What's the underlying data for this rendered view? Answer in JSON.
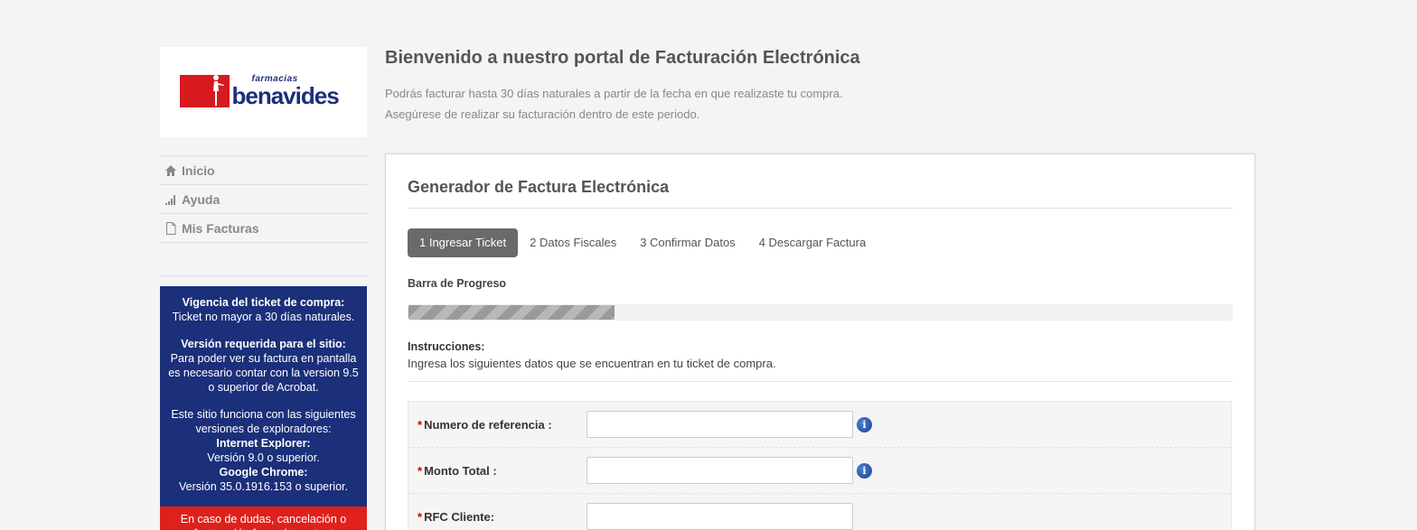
{
  "logo": {
    "small": "farmacias",
    "big": "benavides"
  },
  "nav": [
    {
      "label": "Inicio",
      "icon": "home-icon"
    },
    {
      "label": "Ayuda",
      "icon": "signal-bars-icon"
    },
    {
      "label": "Mis Facturas",
      "icon": "document-icon"
    }
  ],
  "info_box": {
    "vigencia_title": "Vigencia del ticket de compra:",
    "vigencia_text": "Ticket no mayor a 30 días naturales.",
    "version_title": "Versión requerida para el sitio:",
    "version_text": "Para poder ver su factura en pantalla es necesario contar con la version 9.5 o superior de Acrobat.",
    "browsers_text": "Este sitio funciona con las siguientes versiones de exploradores:",
    "ie_title": "Internet Explorer:",
    "ie_text": "Versión 9.0 o superior.",
    "chrome_title": "Google Chrome:",
    "chrome_text": "Versión 35.0.1916.153 o superior.",
    "red_text": "En caso de dudas, cancelación o refacturación favor de contactar"
  },
  "header": {
    "title": "Bienvenido a nuestro portal de Facturación Electrónica",
    "line1": "Podrás facturar hasta 30 días naturales a partir de la fecha en que realizaste tu compra.",
    "line2": "Asegúrese de realizar su facturación dentro de este periodo."
  },
  "panel": {
    "title": "Generador de Factura Electrónica",
    "tabs": [
      "1 Ingresar Ticket",
      "2 Datos Fiscales",
      "3 Confirmar Datos",
      "4 Descargar Factura"
    ],
    "active_tab": 0,
    "progress_label": "Barra de Progreso",
    "progress_percent": 25,
    "instructions_label": "Instrucciones:",
    "instructions_text": "Ingresa los siguientes datos que se encuentran en tu ticket de compra.",
    "fields": [
      {
        "label": "Numero de referencia :",
        "value": "",
        "has_info": true
      },
      {
        "label": "Monto Total :",
        "value": "",
        "has_info": true
      },
      {
        "label": "RFC Cliente:",
        "value": "",
        "has_info": false
      }
    ],
    "required_mark": "*",
    "info_glyph": "i"
  },
  "colors": {
    "brand_blue": "#1b2f7a",
    "brand_red": "#d71920",
    "active_tab": "#6a6a6a"
  }
}
